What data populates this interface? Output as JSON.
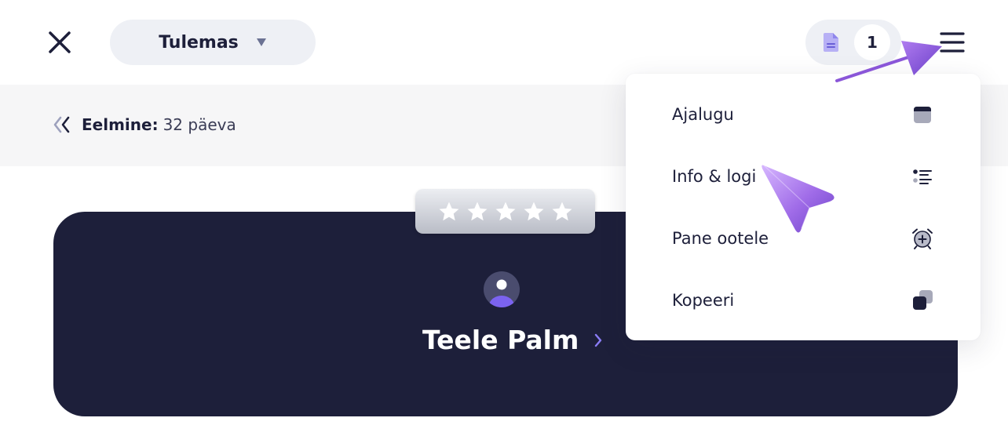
{
  "header": {
    "status_dropdown": {
      "label": "Tulemas",
      "icon": "caret-down-icon"
    },
    "document_counter": {
      "count": "1",
      "icon": "document-icon"
    }
  },
  "previous": {
    "label": "Eelmine:",
    "value": "32 päeva"
  },
  "person": {
    "name": "Teele Palm",
    "rating_stars": 5
  },
  "menu": {
    "items": [
      {
        "label": "Ajalugu",
        "icon": "calendar-icon"
      },
      {
        "label": "Info & logi",
        "icon": "list-icon"
      },
      {
        "label": "Pane ootele",
        "icon": "alarm-add-icon"
      },
      {
        "label": "Kopeeri",
        "icon": "copy-icon"
      }
    ]
  },
  "colors": {
    "dark_navy": "#1d1f3a",
    "accent_purple": "#8a5cf6",
    "pill_bg": "#eef0f5",
    "prev_bar_bg": "#f6f6f7"
  }
}
